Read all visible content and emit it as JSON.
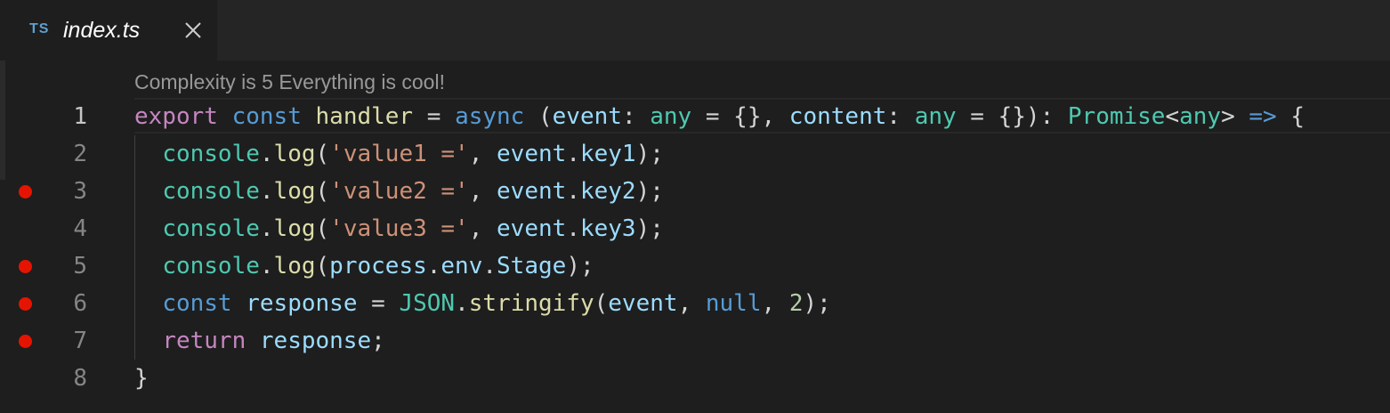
{
  "tab": {
    "icon_text": "TS",
    "filename": "index.ts",
    "close_icon": "close-icon"
  },
  "codelens": "Complexity is 5 Everything is cool!",
  "colors": {
    "background": "#1e1e1e",
    "tabbar": "#252526",
    "breakpoint": "#e51400",
    "keyword": "#569cd6",
    "control": "#c586c0",
    "function": "#dcdcaa",
    "variable": "#9cdcfe",
    "type": "#4ec9b0",
    "string": "#ce9178",
    "number": "#b5cea8"
  },
  "lines": [
    {
      "number": "1",
      "breakpoint": false,
      "current": true,
      "indent": false,
      "tokens": [
        {
          "t": "export",
          "c": "ctrl"
        },
        {
          "t": " ",
          "c": "op"
        },
        {
          "t": "const",
          "c": "kw"
        },
        {
          "t": " ",
          "c": "op"
        },
        {
          "t": "handler",
          "c": "fn"
        },
        {
          "t": " = ",
          "c": "op"
        },
        {
          "t": "async",
          "c": "kw"
        },
        {
          "t": " (",
          "c": "op"
        },
        {
          "t": "event",
          "c": "var"
        },
        {
          "t": ": ",
          "c": "op"
        },
        {
          "t": "any",
          "c": "type"
        },
        {
          "t": " = {}, ",
          "c": "op"
        },
        {
          "t": "content",
          "c": "var"
        },
        {
          "t": ": ",
          "c": "op"
        },
        {
          "t": "any",
          "c": "type"
        },
        {
          "t": " = {}): ",
          "c": "op"
        },
        {
          "t": "Promise",
          "c": "type"
        },
        {
          "t": "<",
          "c": "op"
        },
        {
          "t": "any",
          "c": "type"
        },
        {
          "t": "> ",
          "c": "op"
        },
        {
          "t": "=>",
          "c": "kw"
        },
        {
          "t": " {",
          "c": "op"
        }
      ]
    },
    {
      "number": "2",
      "breakpoint": false,
      "current": false,
      "indent": true,
      "tokens": [
        {
          "t": "  ",
          "c": "op"
        },
        {
          "t": "console",
          "c": "type"
        },
        {
          "t": ".",
          "c": "op"
        },
        {
          "t": "log",
          "c": "fn"
        },
        {
          "t": "(",
          "c": "op"
        },
        {
          "t": "'value1 ='",
          "c": "str"
        },
        {
          "t": ", ",
          "c": "op"
        },
        {
          "t": "event",
          "c": "var"
        },
        {
          "t": ".",
          "c": "op"
        },
        {
          "t": "key1",
          "c": "var"
        },
        {
          "t": ");",
          "c": "op"
        }
      ]
    },
    {
      "number": "3",
      "breakpoint": true,
      "current": false,
      "indent": true,
      "tokens": [
        {
          "t": "  ",
          "c": "op"
        },
        {
          "t": "console",
          "c": "type"
        },
        {
          "t": ".",
          "c": "op"
        },
        {
          "t": "log",
          "c": "fn"
        },
        {
          "t": "(",
          "c": "op"
        },
        {
          "t": "'value2 ='",
          "c": "str"
        },
        {
          "t": ", ",
          "c": "op"
        },
        {
          "t": "event",
          "c": "var"
        },
        {
          "t": ".",
          "c": "op"
        },
        {
          "t": "key2",
          "c": "var"
        },
        {
          "t": ");",
          "c": "op"
        }
      ]
    },
    {
      "number": "4",
      "breakpoint": false,
      "current": false,
      "indent": true,
      "tokens": [
        {
          "t": "  ",
          "c": "op"
        },
        {
          "t": "console",
          "c": "type"
        },
        {
          "t": ".",
          "c": "op"
        },
        {
          "t": "log",
          "c": "fn"
        },
        {
          "t": "(",
          "c": "op"
        },
        {
          "t": "'value3 ='",
          "c": "str"
        },
        {
          "t": ", ",
          "c": "op"
        },
        {
          "t": "event",
          "c": "var"
        },
        {
          "t": ".",
          "c": "op"
        },
        {
          "t": "key3",
          "c": "var"
        },
        {
          "t": ");",
          "c": "op"
        }
      ]
    },
    {
      "number": "5",
      "breakpoint": true,
      "current": false,
      "indent": true,
      "tokens": [
        {
          "t": "  ",
          "c": "op"
        },
        {
          "t": "console",
          "c": "type"
        },
        {
          "t": ".",
          "c": "op"
        },
        {
          "t": "log",
          "c": "fn"
        },
        {
          "t": "(",
          "c": "op"
        },
        {
          "t": "process",
          "c": "var"
        },
        {
          "t": ".",
          "c": "op"
        },
        {
          "t": "env",
          "c": "var"
        },
        {
          "t": ".",
          "c": "op"
        },
        {
          "t": "Stage",
          "c": "var"
        },
        {
          "t": ");",
          "c": "op"
        }
      ]
    },
    {
      "number": "6",
      "breakpoint": true,
      "current": false,
      "indent": true,
      "tokens": [
        {
          "t": "  ",
          "c": "op"
        },
        {
          "t": "const",
          "c": "kw"
        },
        {
          "t": " ",
          "c": "op"
        },
        {
          "t": "response",
          "c": "var"
        },
        {
          "t": " = ",
          "c": "op"
        },
        {
          "t": "JSON",
          "c": "type"
        },
        {
          "t": ".",
          "c": "op"
        },
        {
          "t": "stringify",
          "c": "fn"
        },
        {
          "t": "(",
          "c": "op"
        },
        {
          "t": "event",
          "c": "var"
        },
        {
          "t": ", ",
          "c": "op"
        },
        {
          "t": "null",
          "c": "kw"
        },
        {
          "t": ", ",
          "c": "op"
        },
        {
          "t": "2",
          "c": "num"
        },
        {
          "t": ");",
          "c": "op"
        }
      ]
    },
    {
      "number": "7",
      "breakpoint": true,
      "current": false,
      "indent": true,
      "tokens": [
        {
          "t": "  ",
          "c": "op"
        },
        {
          "t": "return",
          "c": "ctrl"
        },
        {
          "t": " ",
          "c": "op"
        },
        {
          "t": "response",
          "c": "var"
        },
        {
          "t": ";",
          "c": "op"
        }
      ]
    },
    {
      "number": "8",
      "breakpoint": false,
      "current": false,
      "indent": false,
      "tokens": [
        {
          "t": "}",
          "c": "op"
        }
      ]
    }
  ]
}
